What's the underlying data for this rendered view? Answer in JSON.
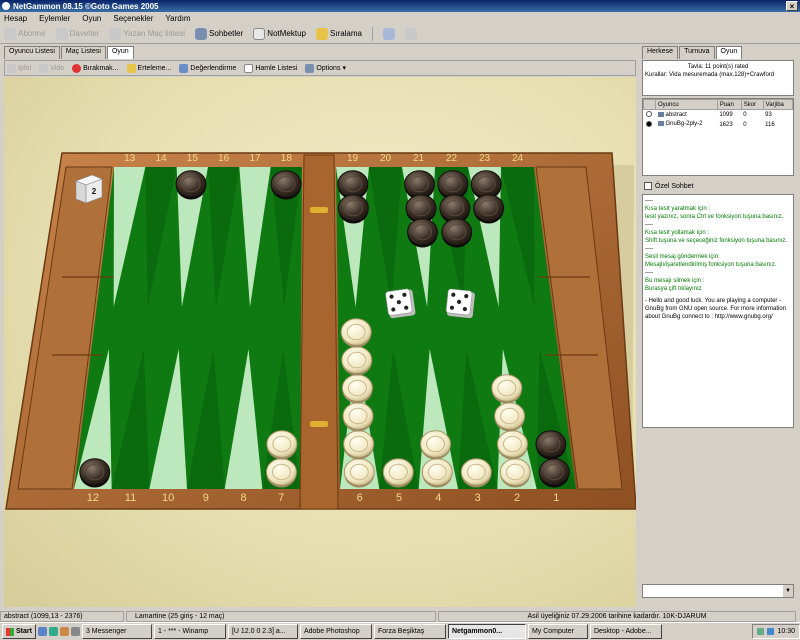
{
  "window": {
    "title": "NetGammon 08.15 ©Goto Games 2005",
    "close": "×"
  },
  "menu": [
    "Hesap",
    "Eylemler",
    "Oyun",
    "Seçenekler",
    "Yardım"
  ],
  "toolbar": [
    {
      "label": "Abonne",
      "state": "disabled",
      "icon": "shield-icon"
    },
    {
      "label": "Davetler",
      "state": "disabled",
      "icon": "envelope-icon"
    },
    {
      "label": "Yazan Maç listesi",
      "state": "disabled",
      "icon": "list-icon"
    },
    {
      "label": "Sohbetler",
      "state": "enabled",
      "icon": "chat-icon"
    },
    {
      "label": "NotMektup",
      "state": "enabled",
      "icon": "mail-icon"
    },
    {
      "label": "Sıralama",
      "state": "enabled",
      "icon": "ranking-icon"
    }
  ],
  "left_tabs": [
    "Oyuncu Listesi",
    "Maç Listesi",
    "Oyun"
  ],
  "left_tab_selected": 2,
  "subtoolbar": [
    {
      "label": "Ipfal",
      "state": "disabled",
      "icon": "undo-icon"
    },
    {
      "label": "Vido",
      "state": "disabled",
      "icon": "video-icon"
    },
    {
      "label": "Bırakmak...",
      "state": "enabled",
      "icon": "resign-icon"
    },
    {
      "label": "Erteleme...",
      "state": "enabled",
      "icon": "postpone-icon"
    },
    {
      "label": "Değerlendirme",
      "state": "enabled",
      "icon": "evaluate-icon"
    },
    {
      "label": "Hamle Listesi",
      "state": "enabled",
      "icon": "movelist-icon"
    },
    {
      "label": "Options",
      "state": "enabled",
      "icon": "options-icon"
    }
  ],
  "board": {
    "top_numbers": [
      "13",
      "14",
      "15",
      "16",
      "17",
      "18",
      "19",
      "20",
      "21",
      "22",
      "23",
      "24"
    ],
    "bottom_numbers": [
      "12",
      "11",
      "10",
      "9",
      "8",
      "7",
      "6",
      "5",
      "4",
      "3",
      "2",
      "1"
    ],
    "cube": "2",
    "dice": [
      5,
      5
    ],
    "checkers": {
      "dark": [
        {
          "point": 15,
          "count": 1
        },
        {
          "point": 18,
          "count": 1
        },
        {
          "point": 19,
          "count": 2
        },
        {
          "point": 21,
          "count": 3
        },
        {
          "point": 22,
          "count": 3
        },
        {
          "point": 23,
          "count": 2
        },
        {
          "point": 12,
          "count": 1
        },
        {
          "point": 1,
          "count": 2
        }
      ],
      "light": [
        {
          "point": 7,
          "count": 2
        },
        {
          "point": 6,
          "count": 6
        },
        {
          "point": 5,
          "count": 1
        },
        {
          "point": 4,
          "count": 2
        },
        {
          "point": 3,
          "count": 1
        },
        {
          "point": 2,
          "count": 4
        }
      ]
    }
  },
  "right_tabs": [
    "Herkese",
    "Turnuva",
    "Oyun"
  ],
  "right_tab_selected": 2,
  "match_info": {
    "line1": "Tavla: 11 point(s) rated",
    "line2": "Kurallar: Vida mesuremada (max.128)+Crawford"
  },
  "players_table": {
    "headers": [
      "Oyuncu",
      "Puan",
      "Skor",
      "Varjiba"
    ],
    "rows": [
      {
        "name": "abstract",
        "rating": "1099",
        "score": "0",
        "pips": "93",
        "turn": false
      },
      {
        "name": "GnuBg-2ply-2",
        "rating": "1623",
        "score": "0",
        "pips": "116",
        "turn": true
      }
    ]
  },
  "private_chat_label": "Özel Sohbet",
  "chat": [
    {
      "color": "black",
      "text": "----"
    },
    {
      "color": "green",
      "text": "Kısa tesit yaratmak için :"
    },
    {
      "color": "green",
      "text": "tesit yazınız, sonra Ctrl ve fonksiyon tuşuna basınız."
    },
    {
      "color": "black",
      "text": "----"
    },
    {
      "color": "green",
      "text": "Kısa tesit yollamak için :"
    },
    {
      "color": "green",
      "text": "Shift tuşuna ve seçeceğiniz fonksiyon tuşuna basınız."
    },
    {
      "color": "black",
      "text": "----"
    },
    {
      "color": "green",
      "text": "Sesli mesaj göndermek için:"
    },
    {
      "color": "green",
      "text": "Mesajlı/işaretlendirilmiş fonksiyon tuşuna basınız."
    },
    {
      "color": "black",
      "text": "----"
    },
    {
      "color": "green",
      "text": "Bu mesajı silmek için :"
    },
    {
      "color": "green",
      "text": "Burasya çift tıklayınız"
    },
    {
      "color": "black",
      "text": "- Hello and good luck. You are playing a computer - GnuBg from GNU open source. For more information about GnuBg connect to : http://www.gnubg.org/"
    }
  ],
  "status": {
    "left": "abstract (1099,13 - 2376)",
    "mid": "Lamartine (25 giriş - 12 maç)",
    "right": "Asil üyeliğiniz 07.29.2006 tarihine kadardır. 10K-DJARUM"
  },
  "taskbar": {
    "start": "Start",
    "tasks": [
      {
        "label": "3 Messenger",
        "selected": false
      },
      {
        "label": "1 - *** - Winamp",
        "selected": false
      },
      {
        "label": "[U 12.0 0 2.3] a...",
        "selected": false
      },
      {
        "label": "Adobe Photoshop",
        "selected": false
      },
      {
        "label": "Forza Beşiktaş",
        "selected": false
      },
      {
        "label": "Netgammon0...",
        "selected": true
      },
      {
        "label": "My Computer",
        "selected": false
      },
      {
        "label": "Desktop - Adobe...",
        "selected": false
      }
    ],
    "clock": "10:30"
  }
}
